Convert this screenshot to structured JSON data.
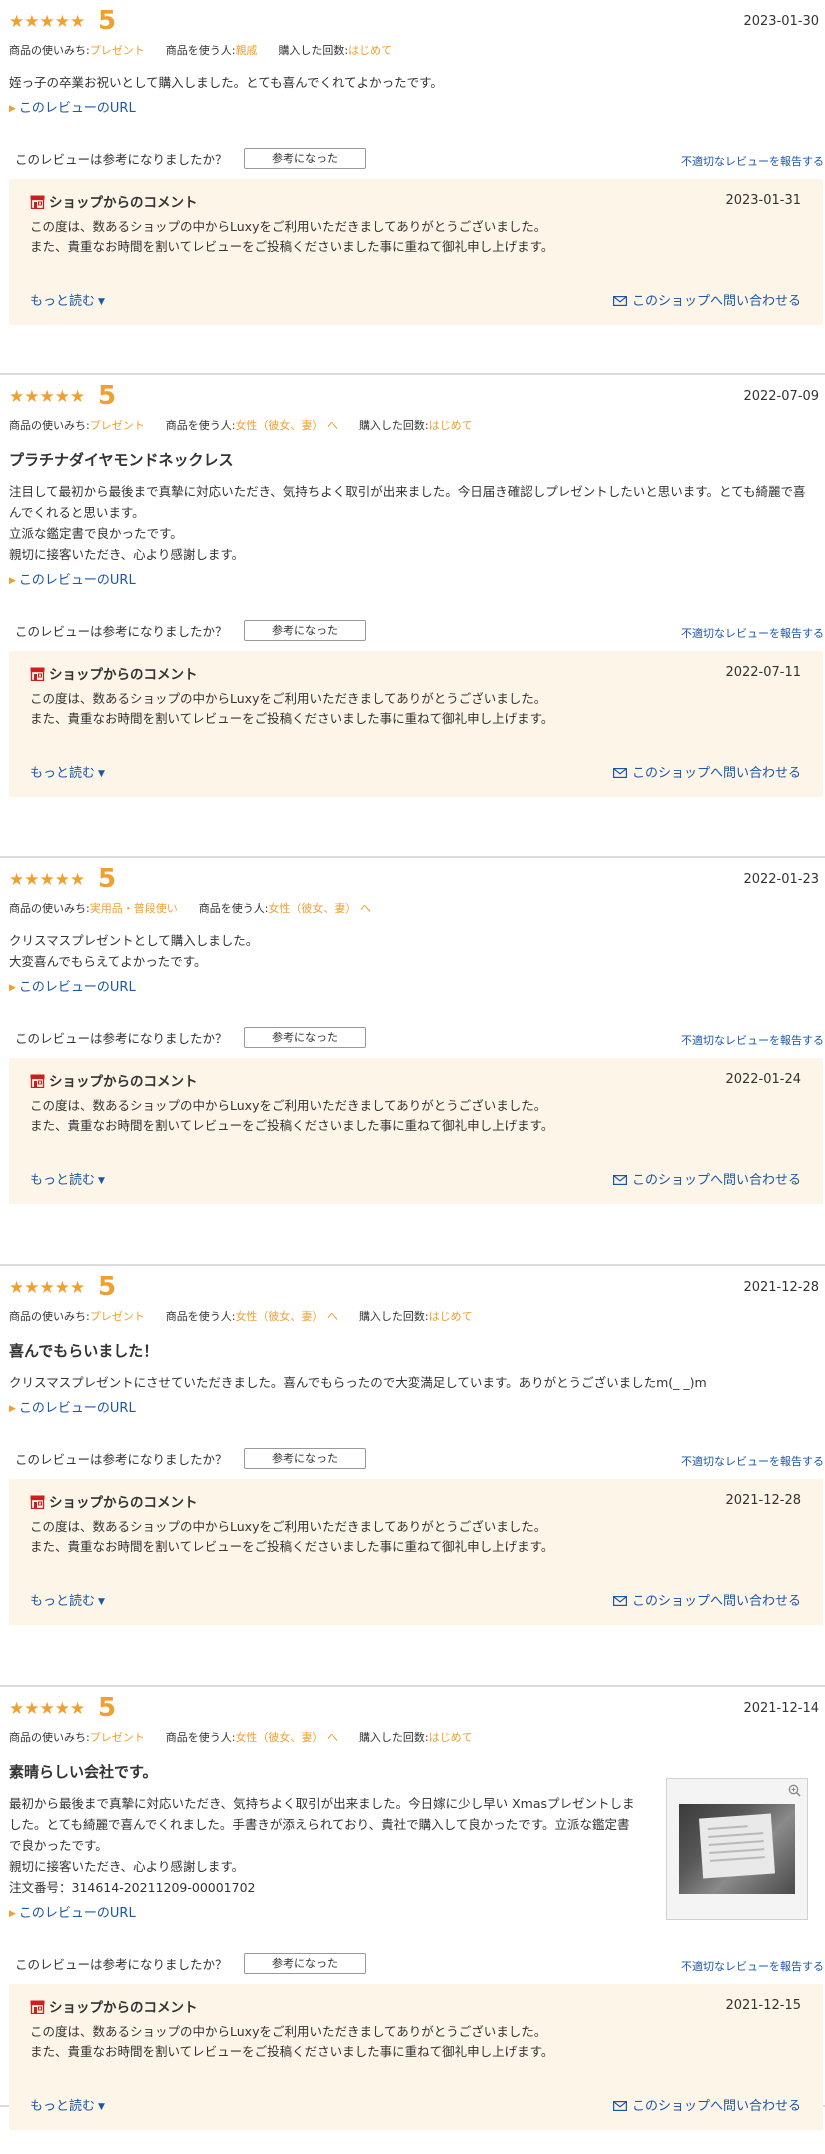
{
  "labels": {
    "stars": "★★★★★",
    "usage_label": "商品の使いみち:",
    "user_label": "商品を使う人:",
    "count_label": "購入した回数:",
    "url_link": "このレビューのURL",
    "helpful_question": "このレビューは参考になりましたか？",
    "helpful_button": "参考になった",
    "report_link": "不適切なレビューを報告する",
    "shop_comment_label": "ショップからのコメント",
    "shop_message_1": "この度は、数あるショップの中からLuxyをご利用いただきましてありがとうございました。",
    "shop_message_2": "また、貴重なお時間を割いてレビューをご投稿くださいました事に重ねて御礼申し上げます。",
    "more_link": "もっと読む",
    "contact_link": "このショップへ問い合わせる"
  },
  "colors": {
    "accent": "#f0a030",
    "link": "#1b57a8",
    "shop_bg": "#fdf5e8",
    "shop_icon": "#cc1f1f"
  },
  "icons": {
    "star": "star-icon",
    "shop": "shop-icon",
    "mail": "mail-icon",
    "zoom": "zoom-icon",
    "chevron": "chevron-down-icon"
  },
  "reviews": [
    {
      "score": "5",
      "date": "2023-01-30",
      "usage": "プレゼント",
      "user": "親戚",
      "user_chevron": "へ",
      "count": "はじめて",
      "title": "",
      "body": [
        "姪っ子の卒業お祝いとして購入しました。とても喜んでくれてよかったです。"
      ],
      "shop_date": "2023-01-31"
    },
    {
      "score": "5",
      "date": "2022-07-09",
      "usage": "プレゼント",
      "user": "女性（彼女、妻）",
      "user_chevron": "へ",
      "count": "はじめて",
      "title": "プラチナダイヤモンドネックレス",
      "body": [
        "注目して最初から最後まで真摯に対応いただき、気持ちよく取引が出来ました。今日届き確認しプレゼントしたいと思います。とても綺麗で喜んでくれると思います。",
        "立派な鑑定書で良かったです。",
        "親切に接客いただき、心より感謝します。"
      ],
      "shop_date": "2022-07-11"
    },
    {
      "score": "5",
      "date": "2022-01-23",
      "usage": "実用品・普段使い",
      "user": "女性（彼女、妻）",
      "user_chevron": "へ",
      "count": "",
      "title": "",
      "body": [
        "クリスマスプレゼントとして購入しました。",
        "大変喜んでもらえてよかったです。"
      ],
      "shop_date": "2022-01-24"
    },
    {
      "score": "5",
      "date": "2021-12-28",
      "usage": "プレゼント",
      "user": "女性（彼女、妻）",
      "user_chevron": "へ",
      "count": "はじめて",
      "title": "喜んでもらいました！",
      "body": [
        "クリスマスプレゼントにさせていただきました。喜んでもらったので大変満足しています。ありがとうございましたm(_ _)m"
      ],
      "shop_date": "2021-12-28"
    },
    {
      "score": "5",
      "date": "2021-12-14",
      "usage": "プレゼント",
      "user": "女性（彼女、妻）",
      "user_chevron": "へ",
      "count": "はじめて",
      "title": "素晴らしい会社です。",
      "body": [
        "最初から最後まで真摯に対応いただき、気持ちよく取引が出来ました。今日嫁に少し早い Xmasプレゼントしました。とても綺麗で喜んでくれました。手書きが添えられており、貴社で購入して良かったです。立派な鑑定書で良かったです。",
        "親切に接客いただき、心より感謝します。",
        "注文番号：314614-20211209-00001702"
      ],
      "shop_date": "2021-12-15",
      "has_image": true
    }
  ]
}
